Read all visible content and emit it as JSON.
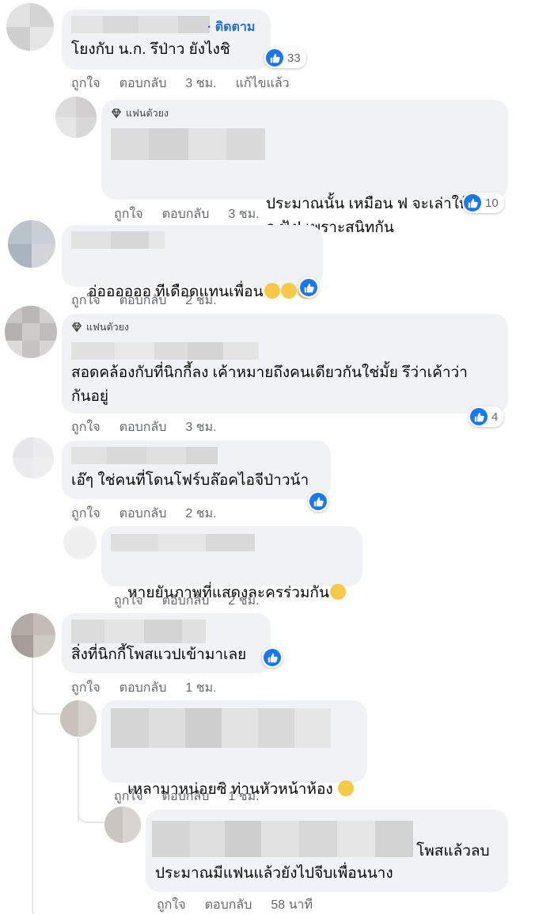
{
  "labels": {
    "like": "ถูกใจ",
    "reply": "ตอบกลับ",
    "edited": "แก้ไขแล้ว",
    "follow": "· ติดตาม",
    "fan_badge": "แฟนตัวยง"
  },
  "colors": {
    "bubble": "#f0f2f5",
    "like_blue": "#1877f2",
    "meta_gray": "#65676b",
    "follow_blue": "#216fdb"
  },
  "comments": [
    {
      "text": "โยงกับ น.ก. รึป่าว ยังไงชิ",
      "time": "3 ชม.",
      "reactions": "33"
    },
    {
      "text": "ประมาณนั้น เหมือน ฟ จะเล่าให้ น\nก ฟัง! เพราะสนิทกัน",
      "time": "3 ชม.",
      "reactions": "10"
    },
    {
      "text": "อ่ออออออ ทีเดือดแทนเพื่อน",
      "time": "2 ชม."
    },
    {
      "text": "สอดคล้องกับที่นิกกี้ลง เค้าหมายถึงคนเดียวกันใช่มั้ย รึว่าเค้าว่า\nกันอยู่",
      "time": "3 ชม.",
      "reactions": "4"
    },
    {
      "text": "เอ๊ๆ ใช่คนที่โดนโฟร์บล๊อคไอจีป่าวน้า",
      "time": "2 ชม."
    },
    {
      "text": "หายยันภาพที่แสดงละครร่วมกัน",
      "time": "2 ชม."
    },
    {
      "text": "สิ่งที่นิกกี้โพสแวปเข้ามาเลย",
      "time": "1 ชม."
    },
    {
      "text": "เหลามาหน่อยซิ ท่านหัวหน้าห้อง",
      "time": "1 ชม."
    },
    {
      "text_right": "โพสแล้วลบ",
      "text": "ประมาณมีแฟนแล้วยังไปจีบเพื่อนนาง",
      "time": "58 นาที"
    }
  ]
}
